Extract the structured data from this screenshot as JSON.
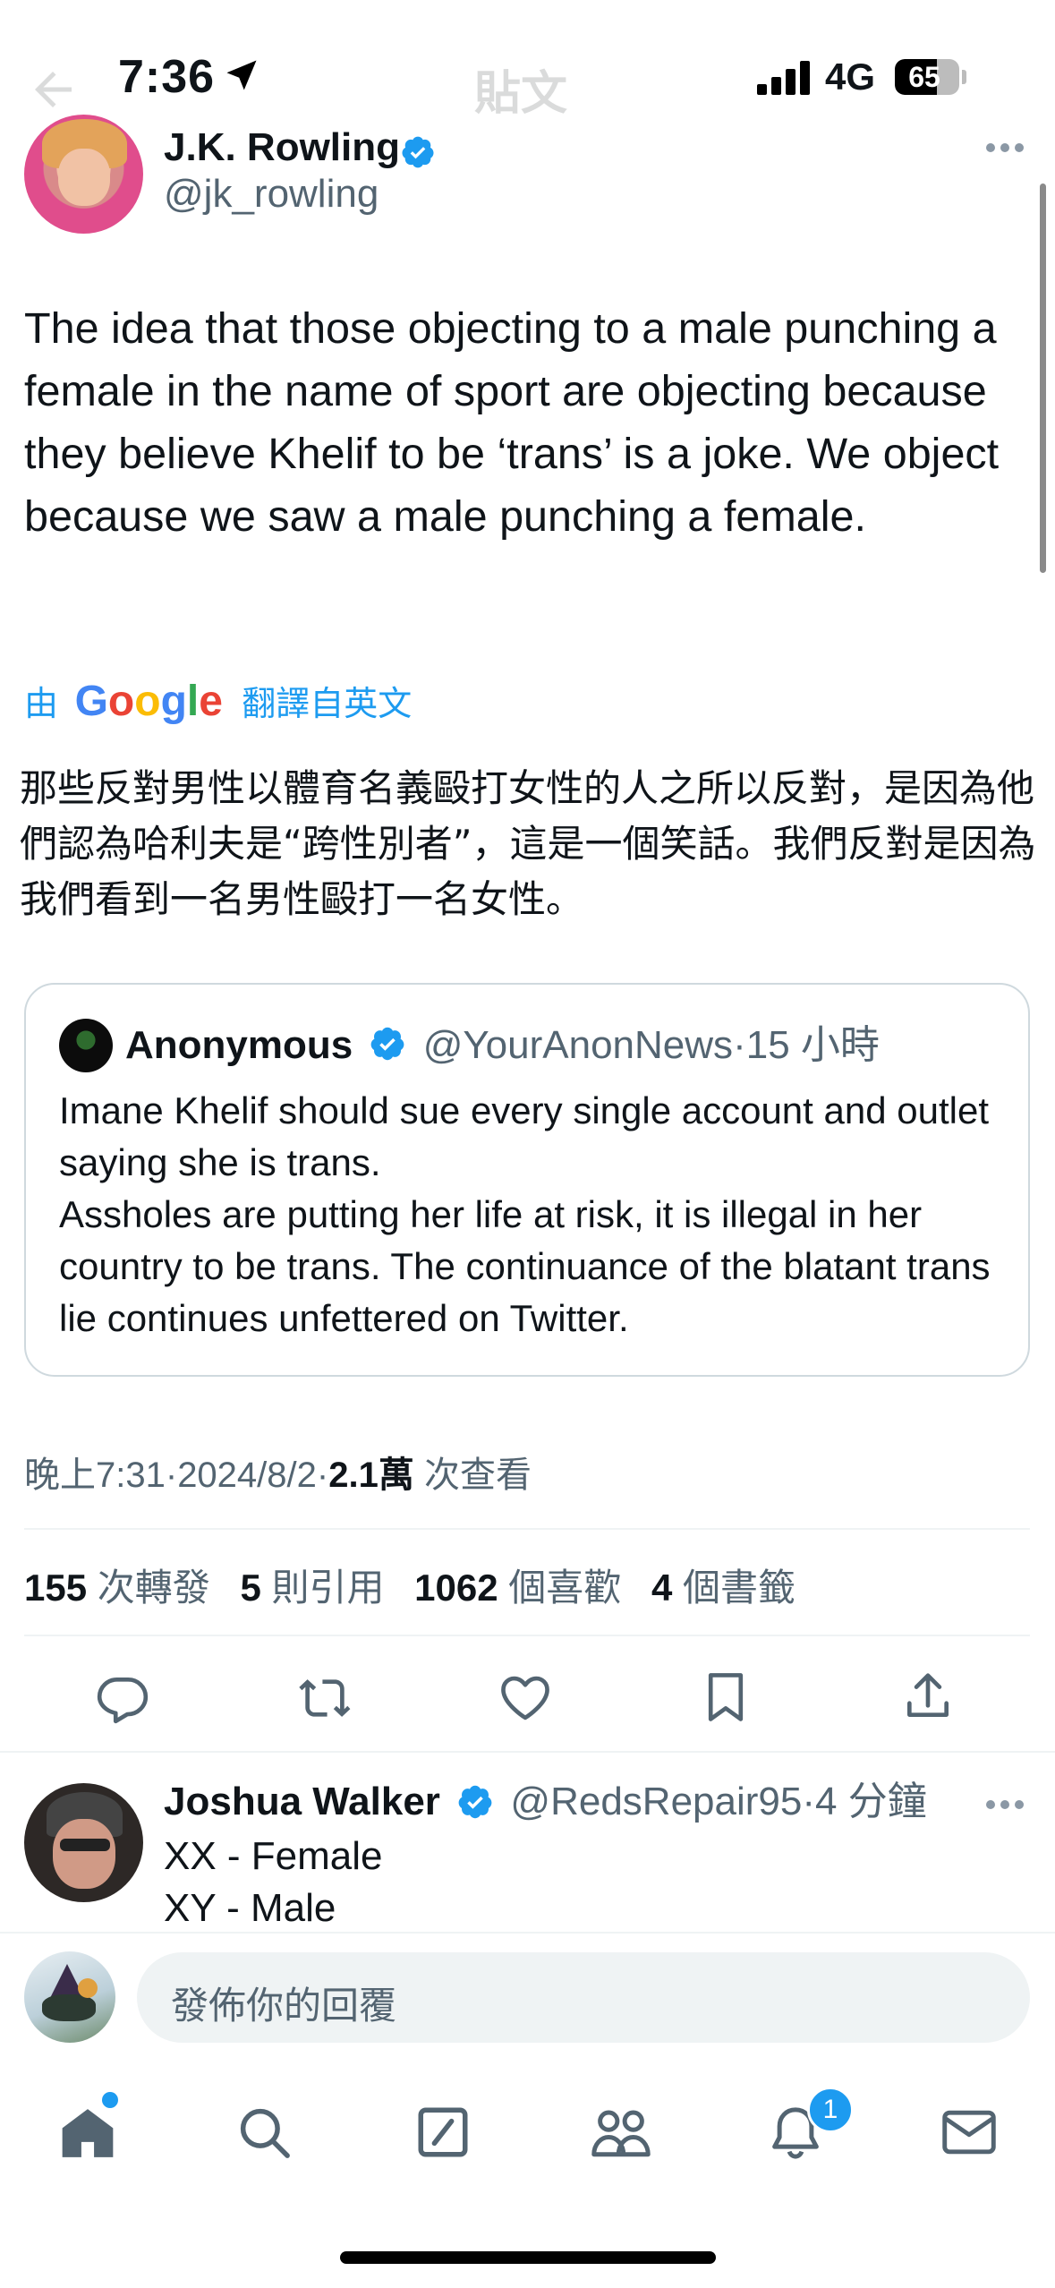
{
  "status_bar": {
    "time": "7:36",
    "network": "4G",
    "battery": "65"
  },
  "header": {
    "title": "貼文"
  },
  "tweet": {
    "author_name": "J.K. Rowling",
    "author_handle": "@jk_rowling",
    "text": "The idea that those objecting to a male punching a female in the name of sport are objecting because they believe Khelif to be ‘trans’ is a joke. We object because we saw a male punching a female.",
    "translation_prefix": "由",
    "translation_logo": "Google",
    "translation_suffix": "翻譯自英文",
    "translation": "那些反對男性以體育名義毆打女性的人之所以反對，是因為他們認為哈利夫是“跨性別者”，這是一個笑話。我們反對是因為我們看到一名男性毆打一名女性。",
    "meta_time": "晚上7:31",
    "meta_date": "2024/8/2",
    "meta_views_count": "2.1萬",
    "meta_views_label": "次查看",
    "stats": [
      {
        "count": "155",
        "label": "次轉發"
      },
      {
        "count": "5",
        "label": "則引用"
      },
      {
        "count": "1062",
        "label": "個喜歡"
      },
      {
        "count": "4",
        "label": "個書籤"
      }
    ]
  },
  "quote": {
    "name": "Anonymous",
    "handle": "@YourAnonNews",
    "time": "15 小時",
    "line1": "Imane Khelif should sue every single account and outlet saying she is trans.",
    "line2": "Assholes are putting her life at risk, it is illegal in her country to be trans. The continuance of the blatant trans lie continues unfettered on Twitter."
  },
  "reply": {
    "name": "Joshua Walker",
    "handle": "@RedsRepair95",
    "time": "4 分鐘",
    "line1": "XX - Female",
    "line2": "XY - Male"
  },
  "compose": {
    "placeholder": "發佈你的回覆"
  },
  "tab_bar": {
    "notification_badge": "1"
  },
  "colors": {
    "accent": "#1d9bf0",
    "text": "#0f1419",
    "muted": "#536471",
    "border": "#cfd9de",
    "google_blue": "#4285F4",
    "google_red": "#EA4335",
    "google_yellow": "#FBBC05",
    "google_green": "#34A853"
  }
}
